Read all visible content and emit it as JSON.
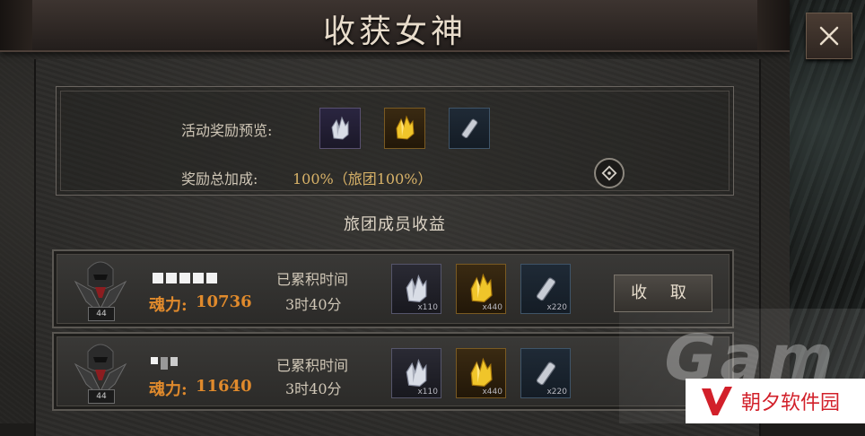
{
  "title": "收获女神",
  "preview": {
    "label": "活动奖励预览:",
    "bonus_label": "奖励总加成:",
    "bonus_value": "100%（旅团100%）",
    "items": [
      {
        "icon": "silver-crystal-icon"
      },
      {
        "icon": "gold-crystal-icon"
      },
      {
        "icon": "whetstone-icon"
      }
    ]
  },
  "section_title": "旅团成员收益",
  "members": [
    {
      "level": "44",
      "power_label": "魂力:",
      "power_value": "10736",
      "time_label": "已累积时间",
      "time_value": "3时40分",
      "rewards": [
        {
          "icon": "silver-crystal-icon",
          "qty": "x110"
        },
        {
          "icon": "gold-crystal-icon",
          "qty": "x440"
        },
        {
          "icon": "whetstone-icon",
          "qty": "x220"
        }
      ]
    },
    {
      "level": "44",
      "power_label": "魂力:",
      "power_value": "11640",
      "time_label": "已累积时间",
      "time_value": "3时40分",
      "rewards": [
        {
          "icon": "silver-crystal-icon",
          "qty": "x110"
        },
        {
          "icon": "gold-crystal-icon",
          "qty": "x440"
        },
        {
          "icon": "whetstone-icon",
          "qty": "x220"
        }
      ]
    }
  ],
  "collect_button": "收 取",
  "watermark": {
    "logo_text": "朝夕软件园",
    "bg_text": "Gam"
  },
  "colors": {
    "gold": "#d8b268",
    "orange": "#e08a2c",
    "watermark_red": "#d2202a"
  }
}
